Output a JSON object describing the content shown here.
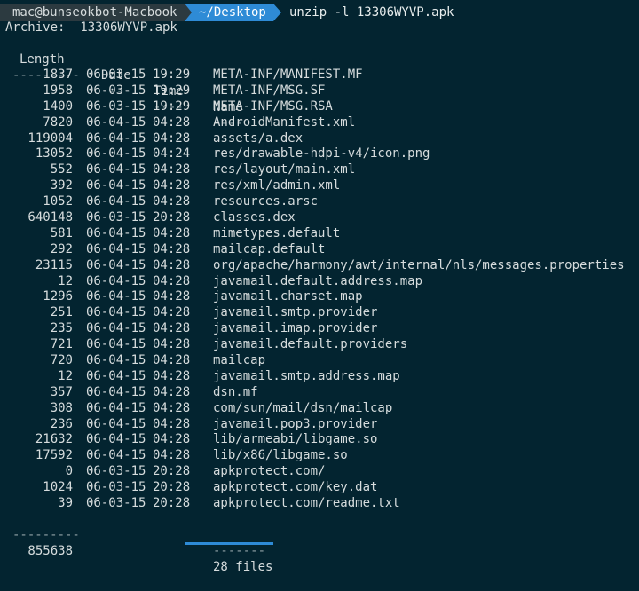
{
  "prompt": {
    "user_host": "mac@bunseokbot-Macbook",
    "directory": "~/Desktop",
    "command": "unzip -l 13306WYVP.apk"
  },
  "archive_line": "Archive:  13306WYVP.apk",
  "headers": {
    "length": "Length",
    "date": "Date",
    "time": "Time",
    "name": "Name"
  },
  "header_rules": {
    "length": "---------",
    "date": "----",
    "time": "----",
    "name": "----"
  },
  "rows": [
    {
      "length": "1837",
      "date": "06-03-15",
      "time": "19:29",
      "name": "META-INF/MANIFEST.MF"
    },
    {
      "length": "1958",
      "date": "06-03-15",
      "time": "19:29",
      "name": "META-INF/MSG.SF"
    },
    {
      "length": "1400",
      "date": "06-03-15",
      "time": "19:29",
      "name": "META-INF/MSG.RSA"
    },
    {
      "length": "7820",
      "date": "06-04-15",
      "time": "04:28",
      "name": "AndroidManifest.xml"
    },
    {
      "length": "119004",
      "date": "06-04-15",
      "time": "04:28",
      "name": "assets/a.dex"
    },
    {
      "length": "13052",
      "date": "06-04-15",
      "time": "04:24",
      "name": "res/drawable-hdpi-v4/icon.png"
    },
    {
      "length": "552",
      "date": "06-04-15",
      "time": "04:28",
      "name": "res/layout/main.xml"
    },
    {
      "length": "392",
      "date": "06-04-15",
      "time": "04:28",
      "name": "res/xml/admin.xml"
    },
    {
      "length": "1052",
      "date": "06-04-15",
      "time": "04:28",
      "name": "resources.arsc"
    },
    {
      "length": "640148",
      "date": "06-03-15",
      "time": "20:28",
      "name": "classes.dex"
    },
    {
      "length": "581",
      "date": "06-04-15",
      "time": "04:28",
      "name": "mimetypes.default"
    },
    {
      "length": "292",
      "date": "06-04-15",
      "time": "04:28",
      "name": "mailcap.default"
    },
    {
      "length": "23115",
      "date": "06-04-15",
      "time": "04:28",
      "name": "org/apache/harmony/awt/internal/nls/messages.properties"
    },
    {
      "length": "12",
      "date": "06-04-15",
      "time": "04:28",
      "name": "javamail.default.address.map"
    },
    {
      "length": "1296",
      "date": "06-04-15",
      "time": "04:28",
      "name": "javamail.charset.map"
    },
    {
      "length": "251",
      "date": "06-04-15",
      "time": "04:28",
      "name": "javamail.smtp.provider"
    },
    {
      "length": "235",
      "date": "06-04-15",
      "time": "04:28",
      "name": "javamail.imap.provider"
    },
    {
      "length": "721",
      "date": "06-04-15",
      "time": "04:28",
      "name": "javamail.default.providers"
    },
    {
      "length": "720",
      "date": "06-04-15",
      "time": "04:28",
      "name": "mailcap"
    },
    {
      "length": "12",
      "date": "06-04-15",
      "time": "04:28",
      "name": "javamail.smtp.address.map"
    },
    {
      "length": "357",
      "date": "06-04-15",
      "time": "04:28",
      "name": "dsn.mf"
    },
    {
      "length": "308",
      "date": "06-04-15",
      "time": "04:28",
      "name": "com/sun/mail/dsn/mailcap"
    },
    {
      "length": "236",
      "date": "06-04-15",
      "time": "04:28",
      "name": "javamail.pop3.provider"
    },
    {
      "length": "21632",
      "date": "06-04-15",
      "time": "04:28",
      "name": "lib/armeabi/libgame.so"
    },
    {
      "length": "17592",
      "date": "06-04-15",
      "time": "04:28",
      "name": "lib/x86/libgame.so"
    },
    {
      "length": "0",
      "date": "06-03-15",
      "time": "20:28",
      "name": "apkprotect.com/"
    },
    {
      "length": "1024",
      "date": "06-03-15",
      "time": "20:28",
      "name": "apkprotect.com/key.dat"
    },
    {
      "length": "39",
      "date": "06-03-15",
      "time": "20:28",
      "name": "apkprotect.com/readme.txt"
    }
  ],
  "footer_rules": {
    "length": "---------",
    "name": "-------"
  },
  "footer": {
    "total_length": "855638",
    "total_files": "28 files"
  },
  "colors": {
    "background": "#032430",
    "prompt_segment": "#2c3a40",
    "directory_segment": "#2e8bd6",
    "text": "#d6dcdd"
  }
}
